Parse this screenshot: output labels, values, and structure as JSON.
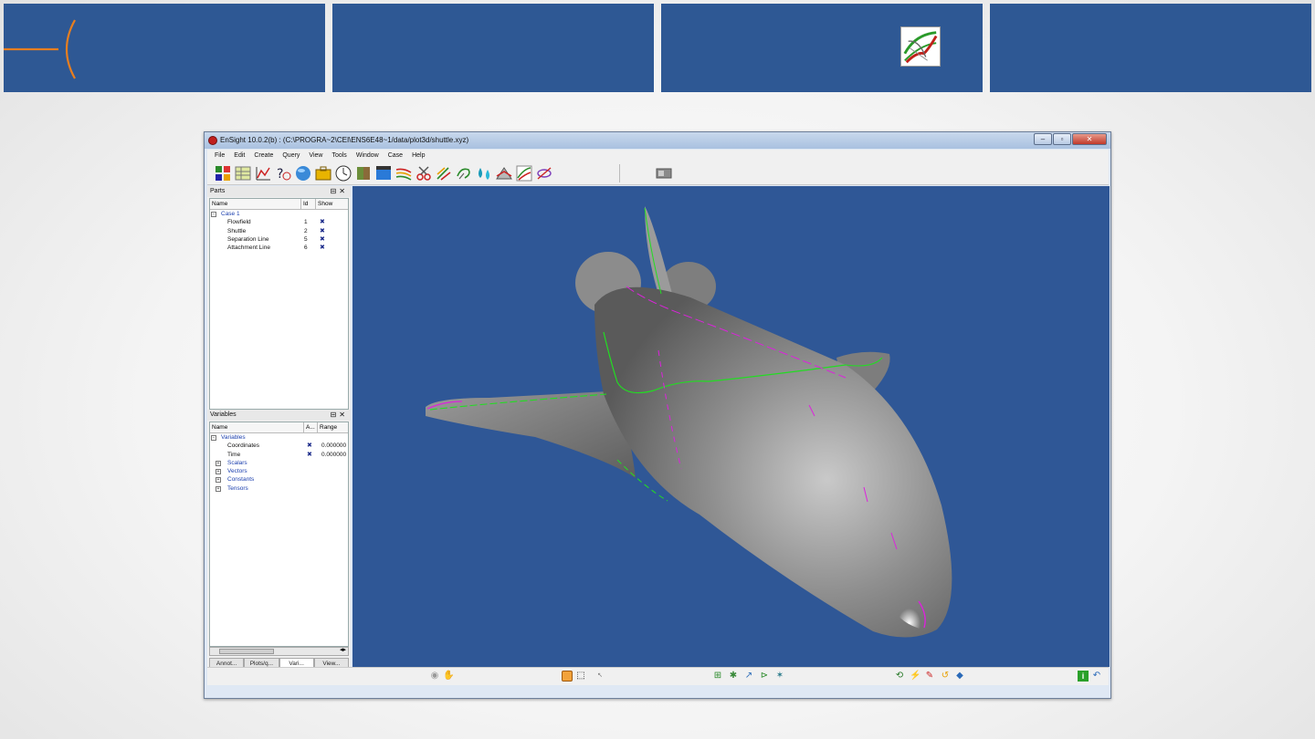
{
  "slide": {
    "header_segments": 4
  },
  "window": {
    "title": "EnSight 10.0.2(b) :  (C:\\PROGRA~2\\CEI\\ENS6E48~1/data/plot3d/shuttle.xyz)",
    "controls": {
      "minimize": "–",
      "maximize": "▫",
      "close": "✕"
    }
  },
  "menu": [
    "File",
    "Edit",
    "Create",
    "Query",
    "View",
    "Tools",
    "Window",
    "Case",
    "Help"
  ],
  "parts_panel": {
    "title": "Parts",
    "columns": [
      "Name",
      "Id",
      "Show"
    ],
    "case_label": "Case 1",
    "rows": [
      {
        "name": "Flowfield",
        "id": "1"
      },
      {
        "name": "Shuttle",
        "id": "2"
      },
      {
        "name": "Separation Line",
        "id": "5"
      },
      {
        "name": "Attachment Line",
        "id": "6"
      }
    ]
  },
  "variables_panel": {
    "title": "Variables",
    "columns": [
      "Name",
      "A...",
      "Range"
    ],
    "root_label": "Variables",
    "rows": [
      {
        "name": "Coordinates",
        "range": "0.000000"
      },
      {
        "name": "Time",
        "range": "0.000000"
      }
    ],
    "groups": [
      "Scalars",
      "Vectors",
      "Constants",
      "Tensors"
    ]
  },
  "tabs": [
    "Annot...",
    "Plots/q...",
    "Vari...",
    "View..."
  ],
  "active_tab_index": 2,
  "colors": {
    "slide_band": "#2e5894",
    "viewport_bg": "#2f5796",
    "deco_orange": "#e87e1f",
    "separation_line": "#22dd22",
    "attachment_line": "#dd22dd"
  }
}
